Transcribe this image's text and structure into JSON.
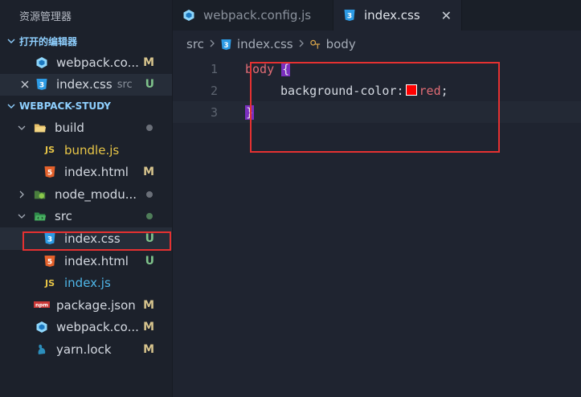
{
  "sidebar": {
    "title": "资源管理器",
    "open_editors_header": "打开的编辑器",
    "project_header": "WEBPACK-STUDY",
    "open_editors": [
      {
        "name": "webpack.co...",
        "status": "M"
      },
      {
        "name": "index.css",
        "suffix": "src",
        "status": "U"
      }
    ],
    "tree": [
      {
        "name": "build",
        "status": "dot"
      },
      {
        "name": "bundle.js"
      },
      {
        "name": "index.html",
        "status": "M"
      },
      {
        "name": "node_modu...",
        "status": "dot"
      },
      {
        "name": "src",
        "status": "dot"
      },
      {
        "name": "index.css",
        "status": "U"
      },
      {
        "name": "index.html",
        "status": "U"
      },
      {
        "name": "index.js"
      },
      {
        "name": "package.json",
        "status": "M"
      },
      {
        "name": "webpack.co...",
        "status": "M"
      },
      {
        "name": "yarn.lock",
        "status": "M"
      }
    ]
  },
  "tabs": [
    {
      "label": "webpack.config.js"
    },
    {
      "label": "index.css",
      "close": "✕"
    }
  ],
  "breadcrumb": [
    "src",
    "index.css",
    "body"
  ],
  "editor": {
    "line_numbers": [
      "1",
      "2",
      "3"
    ],
    "line1": {
      "selector": "body",
      "open": "{"
    },
    "line2": {
      "property": "background-color",
      "colon": ":",
      "value": "red",
      "semi": ";"
    },
    "line3": {
      "close": "}"
    },
    "swatch_color": "#ff0000"
  },
  "colors": {
    "status_modified": "#d7c48d",
    "status_untracked": "#7fc38b",
    "section_header": "#8fd0ff",
    "highlight_box": "#e53131"
  }
}
